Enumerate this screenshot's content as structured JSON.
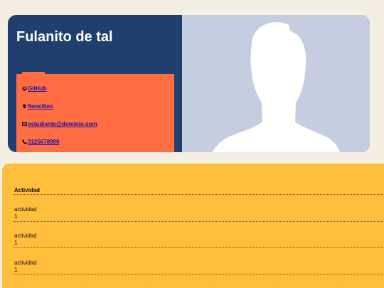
{
  "profile": {
    "name": "Fulanito de tal",
    "links": [
      {
        "icon": "github-icon",
        "label": "GitHub"
      },
      {
        "icon": "location-pin-icon",
        "label": "Neocities"
      },
      {
        "icon": "envelope-icon",
        "label": "estudiante@dominio.com"
      },
      {
        "icon": "phone-icon",
        "label": "3125678900"
      }
    ]
  },
  "activities": {
    "header": "Actividad",
    "rows": [
      {
        "name": "actividad",
        "value": "1"
      },
      {
        "name": "actividad",
        "value": "1"
      },
      {
        "name": "actividad",
        "value": "1"
      }
    ]
  },
  "colors": {
    "header_bg": "#1f3f6e",
    "contact_bg": "#ff6e42",
    "photo_bg": "#c5cee1",
    "activity_bg": "#ffbe3c",
    "page_bg": "#f5efe3"
  }
}
